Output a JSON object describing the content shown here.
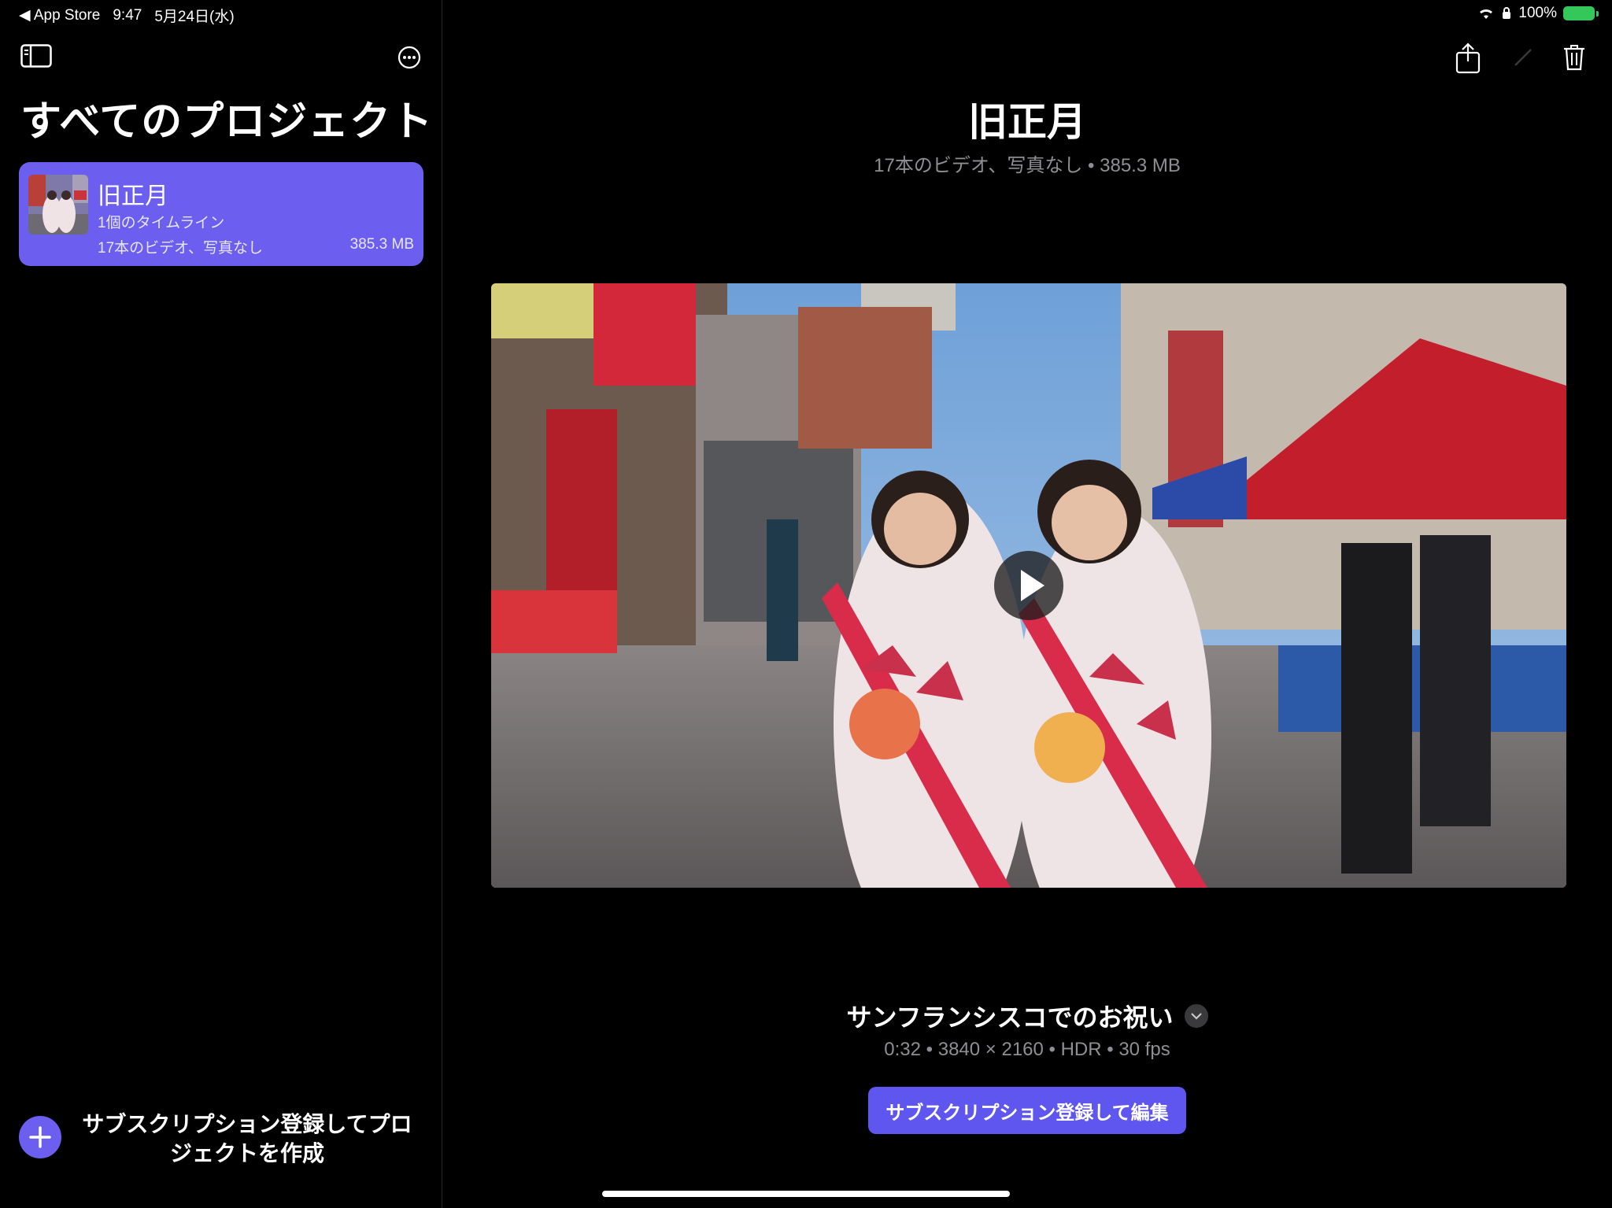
{
  "status_bar": {
    "back_app": "◀ App Store",
    "time": "9:47",
    "date": "5月24日(水)",
    "battery": "100%"
  },
  "sidebar": {
    "title": "すべてのプロジェクト",
    "projects": [
      {
        "name": "旧正月",
        "timelines": "1個のタイムライン",
        "details": "17本のビデオ、写真なし",
        "size": "385.3 MB"
      }
    ],
    "create_label": "サブスクリプション登録してプロジェクトを作成"
  },
  "main": {
    "title": "旧正月",
    "subtitle": "17本のビデオ、写真なし • 385.3 MB",
    "clip": {
      "name": "サンフランシスコでのお祝い",
      "meta": "0:32 • 3840 × 2160 • HDR • 30 fps"
    },
    "edit_button": "サブスクリプション登録して編集"
  },
  "icons": {
    "sidebar_toggle": "sidebar-icon",
    "more": "ellipsis-circle-icon",
    "share": "share-icon",
    "edit": "pencil-icon",
    "delete": "trash-icon",
    "play": "play-icon",
    "add": "plus-icon",
    "expand": "chevron-down-icon"
  },
  "colors": {
    "accent": "#6c5ff0",
    "button": "#5e56ee",
    "secondary_text": "#8e8e93",
    "battery": "#34c759"
  }
}
